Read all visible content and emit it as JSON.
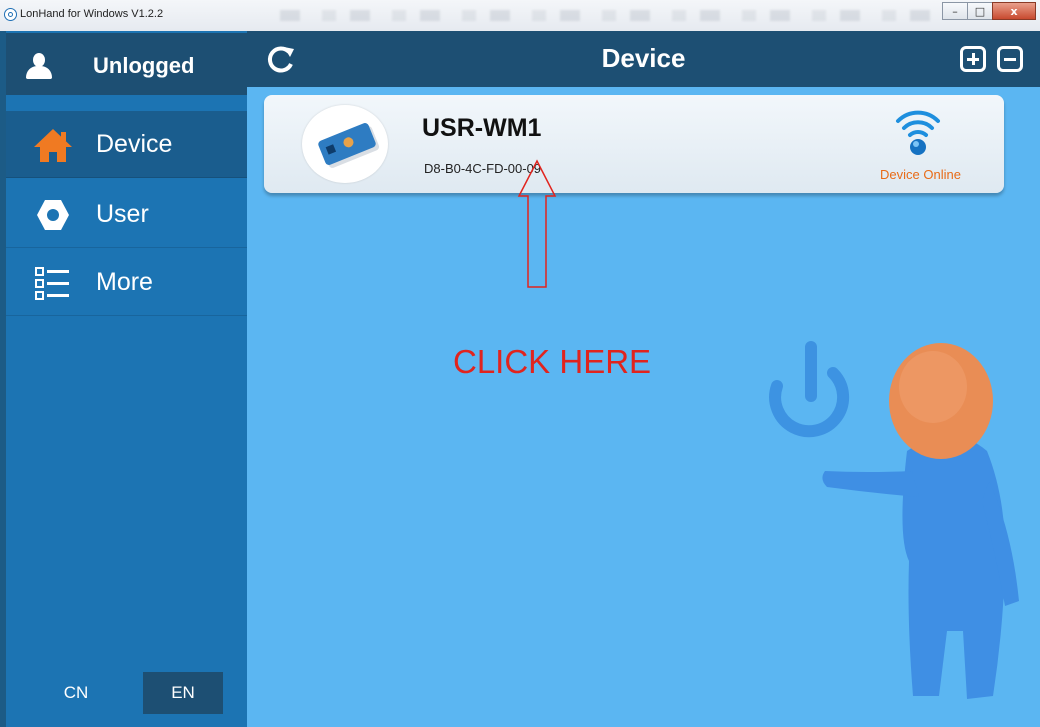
{
  "window": {
    "title": "LonHand for Windows V1.2.2",
    "controls": {
      "minimize": "–",
      "maximize": "□",
      "close": "x"
    }
  },
  "sidebar": {
    "user_label": "Unlogged",
    "items": [
      {
        "label": "Device",
        "icon": "home-icon",
        "active": true
      },
      {
        "label": "User",
        "icon": "gear-icon",
        "active": false
      },
      {
        "label": "More",
        "icon": "list-icon",
        "active": false
      }
    ],
    "languages": [
      {
        "label": "CN",
        "active": false
      },
      {
        "label": "EN",
        "active": true
      }
    ]
  },
  "header": {
    "title": "Device",
    "icons": [
      "refresh-icon",
      "add-icon",
      "remove-icon"
    ]
  },
  "devices": [
    {
      "name": "USR-WM1",
      "mac": "D8-B0-4C-FD-00-09",
      "status": "Device Online",
      "status_color": "#e86b17"
    }
  ],
  "annotation": {
    "text": "CLICK HERE",
    "color": "#e1241e"
  },
  "colors": {
    "sidebar_bg": "#1c74b3",
    "header_bg": "#1d4f73",
    "main_bg": "#5bb6f2",
    "accent_orange": "#f07a22"
  }
}
